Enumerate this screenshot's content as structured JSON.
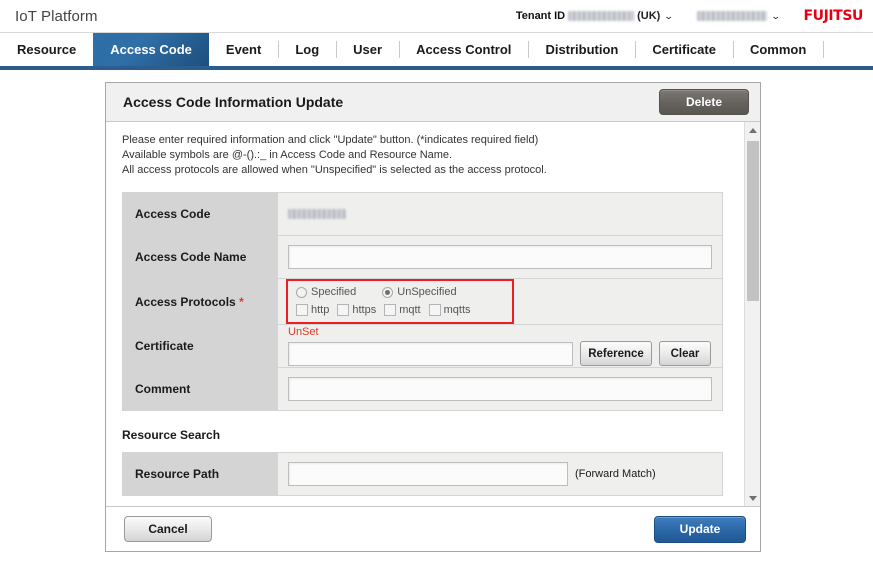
{
  "header": {
    "app_title": "IoT Platform",
    "tenant_label": "Tenant ID",
    "tenant_id": "",
    "tenant_region": "(UK)",
    "user_name": "",
    "logo_text": "FUJITSU",
    "caret": "⌄"
  },
  "nav": {
    "items": [
      {
        "label": "Resource",
        "active": false
      },
      {
        "label": "Access Code",
        "active": true
      },
      {
        "label": "Event",
        "active": false
      },
      {
        "label": "Log",
        "active": false
      },
      {
        "label": "User",
        "active": false
      },
      {
        "label": "Access Control",
        "active": false
      },
      {
        "label": "Distribution",
        "active": false
      },
      {
        "label": "Certificate",
        "active": false
      },
      {
        "label": "Common",
        "active": false
      }
    ]
  },
  "panel": {
    "title": "Access Code Information Update",
    "delete_label": "Delete",
    "notes": [
      "Please enter required information and click \"Update\" button. (*indicates required field)",
      "Available symbols are @-().:_ in Access Code and Resource Name.",
      "All access protocols are allowed when \"Unspecified\" is selected as the access protocol."
    ],
    "fields": {
      "access_code": {
        "label": "Access Code",
        "value": ""
      },
      "access_code_name": {
        "label": "Access Code Name",
        "value": "",
        "placeholder": ""
      },
      "access_protocols": {
        "label": "Access Protocols",
        "required_marker": "*",
        "options": [
          {
            "label": "Specified",
            "selected": false
          },
          {
            "label": "UnSpecified",
            "selected": true
          }
        ],
        "protocols": [
          {
            "label": "http",
            "checked": false
          },
          {
            "label": "https",
            "checked": false
          },
          {
            "label": "mqtt",
            "checked": false
          },
          {
            "label": "mqtts",
            "checked": false
          }
        ]
      },
      "certificate": {
        "label": "Certificate",
        "status": "UnSet",
        "value": "",
        "reference_label": "Reference",
        "clear_label": "Clear"
      },
      "comment": {
        "label": "Comment",
        "value": "",
        "placeholder": ""
      }
    },
    "resource_search": {
      "heading": "Resource Search",
      "resource_path": {
        "label": "Resource Path",
        "value": "",
        "hint": "(Forward Match)"
      }
    }
  },
  "footer": {
    "cancel_label": "Cancel",
    "update_label": "Update"
  },
  "colors": {
    "accent_blue": "#2c5d8f",
    "active_tab": "#2f6ea6",
    "required_red": "#e03a27",
    "highlight_red": "#ee1c25",
    "brand_red": "#e60012"
  }
}
